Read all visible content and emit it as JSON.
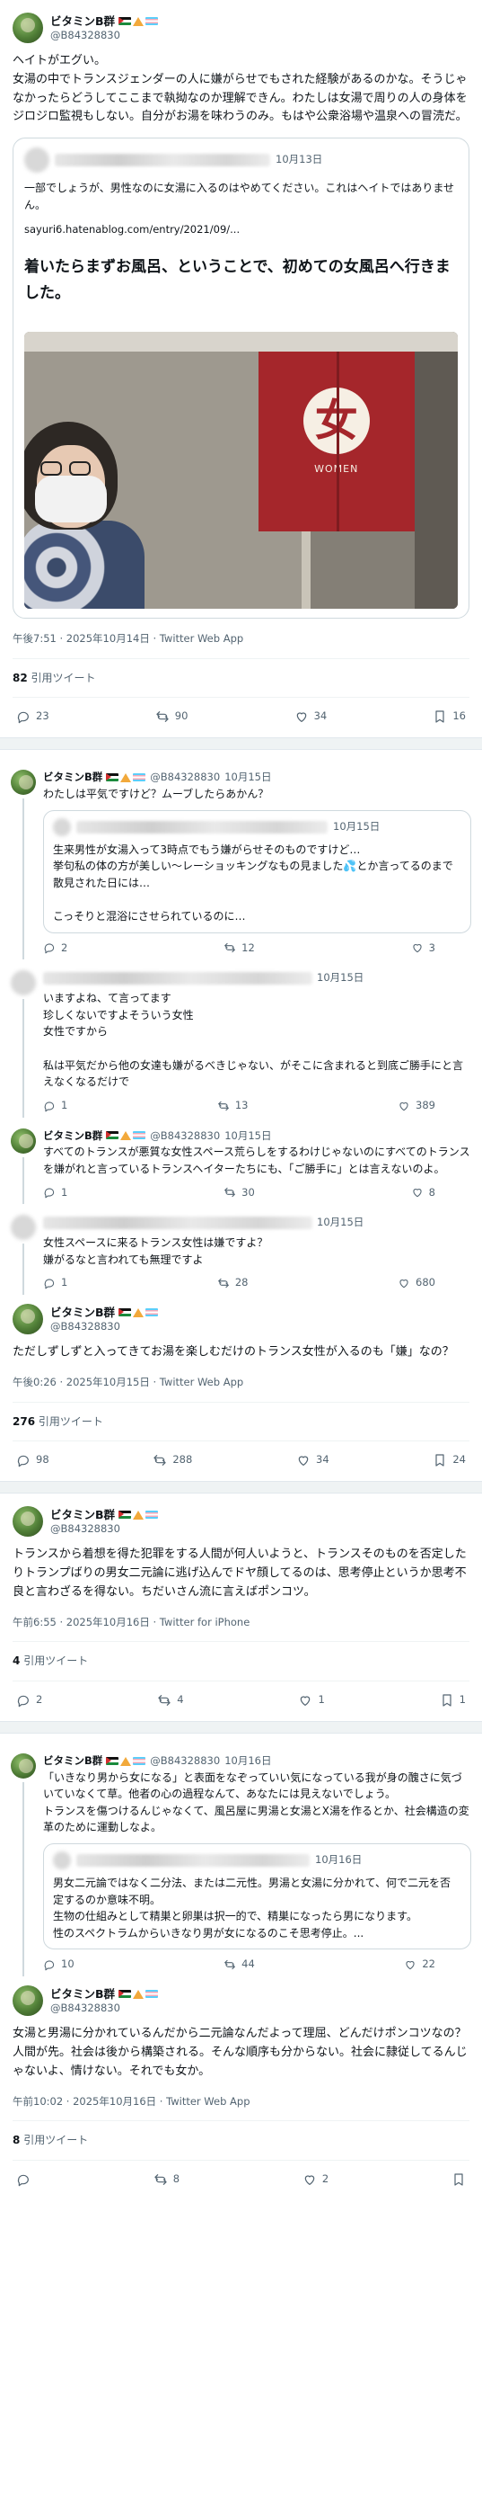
{
  "user": {
    "display_name": "ビタミンB群",
    "handle": "@B84328830"
  },
  "tweet1": {
    "text": "ヘイトがエグい。\n女湯の中でトランスジェンダーの人に嫌がらせでもされた経験があるのかな。そうじゃなかったらどうしてここまで執拗なのか理解できん。わたしは女湯で周りの人の身体をジロジロ監視もしない。自分がお湯を味わうのみ。もはや公衆浴場や温泉への冒涜だ。",
    "quote_date": "10月13日",
    "quote_text": "一部でしょうが、男性なのに女湯に入るのはやめてください。これはヘイトではありません。",
    "quote_url": "sayuri6.hatenablog.com/entry/2021/09/...",
    "blog_title": "着いたらまずお風呂、ということで、初めての女風呂へ行きました。",
    "noren_kanji": "女",
    "noren_word": "WOMEN",
    "meta": "午後7:51 · 2025年10月14日 · Twitter Web App",
    "quote_count": "82",
    "quote_label": "引用ツイート",
    "actions": {
      "reply": "23",
      "retweet": "90",
      "like": "34",
      "bookmark": "16"
    }
  },
  "tweet2": {
    "head_date": "10月15日",
    "head_text": "わたしは平気ですけど？ムーブしたらあかん？",
    "inner_date": "10月15日",
    "inner_text": "生来男性が女湯入って3時点でもう嫌がらせそのものですけど…\n挙句私の体の方が美しい〜レーショッキングなもの見ました💦とか言ってるのまで散見された日には…\n\nこっそりと混浴にさせられているのに…",
    "inner_actions": {
      "reply": "2",
      "retweet": "12",
      "like": "3"
    },
    "r1_date": "10月15日",
    "r1_text": "いますよね、て言ってます\n珍しくないですよそういう女性\n女性ですから\n\n私は平気だから他の女達も嫌がるべきじゃない、がそこに含まれると到底ご勝手にと言えなくなるだけで",
    "r1_actions": {
      "reply": "1",
      "retweet": "13",
      "like": "389"
    },
    "r2_date": "10月15日",
    "r2_text": "すべてのトランスが悪質な女性スペース荒らしをするわけじゃないのにすべてのトランスを嫌がれと言っているトランスヘイターたちにも、「ご勝手に」とは言えないのよ。",
    "r2_actions": {
      "reply": "1",
      "retweet": "30",
      "like": "8"
    },
    "r3_date": "10月15日",
    "r3_text": "女性スペースに来るトランス女性は嫌ですよ？\n嫌がるなと言われても無理ですよ",
    "r3_actions": {
      "reply": "1",
      "retweet": "28",
      "like": "680"
    },
    "text": "ただしずしずと入ってきてお湯を楽しむだけのトランス女性が入るのも「嫌」なの？",
    "meta": "午後0:26 · 2025年10月15日 · Twitter Web App",
    "quote_count": "276",
    "quote_label": "引用ツイート",
    "actions": {
      "reply": "98",
      "retweet": "288",
      "like": "34",
      "bookmark": "24"
    }
  },
  "tweet3": {
    "text": "トランスから着想を得た犯罪をする人間が何人いようと、トランスそのものを否定したりトランプばりの男女二元論に逃げ込んでドヤ顔してるのは、思考停止というか思考不良と言わざるを得ない。ちだいさん流に言えばポンコツ。",
    "meta": "午前6:55 · 2025年10月16日 · Twitter for iPhone",
    "quote_count": "4",
    "quote_label": "引用ツイート",
    "actions": {
      "reply": "2",
      "retweet": "4",
      "like": "1",
      "bookmark": "1"
    }
  },
  "tweet4": {
    "head_date": "10月16日",
    "head_text": "「いきなり男から女になる」と表面をなぞっていい気になっている我が身の醜さに気づいていなくて草。他者の心の過程なんて、あなたには見えないでしょう。\nトランスを傷つけるんじゃなくて、風呂屋に男湯と女湯とX湯を作るとか、社会構造の変革のために運動しなよ。",
    "inner_date": "10月16日",
    "inner_text": "男女二元論ではなく二分法、または二元性。男湯と女湯に分かれて、何で二元を否定するのか意味不明。\n生物の仕組みとして精巣と卵巣は択一的で、精巣になったら男になります。\n性のスペクトラムからいきなり男が女になるのこそ思考停止。...",
    "inner_actions": {
      "reply": "10",
      "retweet": "44",
      "like": "22"
    },
    "text": "女湯と男湯に分かれているんだから二元論なんだよって理屈、どんだけポンコツなの？　人間が先。社会は後から構築される。そんな順序も分からない。社会に隷従してるんじゃないよ、情けない。それでも女か。",
    "meta": "午前10:02 · 2025年10月16日 · Twitter Web App",
    "quote_count": "8",
    "quote_label": "引用ツイート",
    "actions": {
      "retweet": "8",
      "like": "2"
    }
  },
  "icons": {
    "reply": "reply-icon",
    "retweet": "retweet-icon",
    "like": "heart-icon",
    "bookmark": "bookmark-icon"
  },
  "colors": {
    "text": "#0f1419",
    "muted": "#536471",
    "border": "#cfd9de",
    "separator": "#eff3f4",
    "noren": "#a5262b"
  }
}
